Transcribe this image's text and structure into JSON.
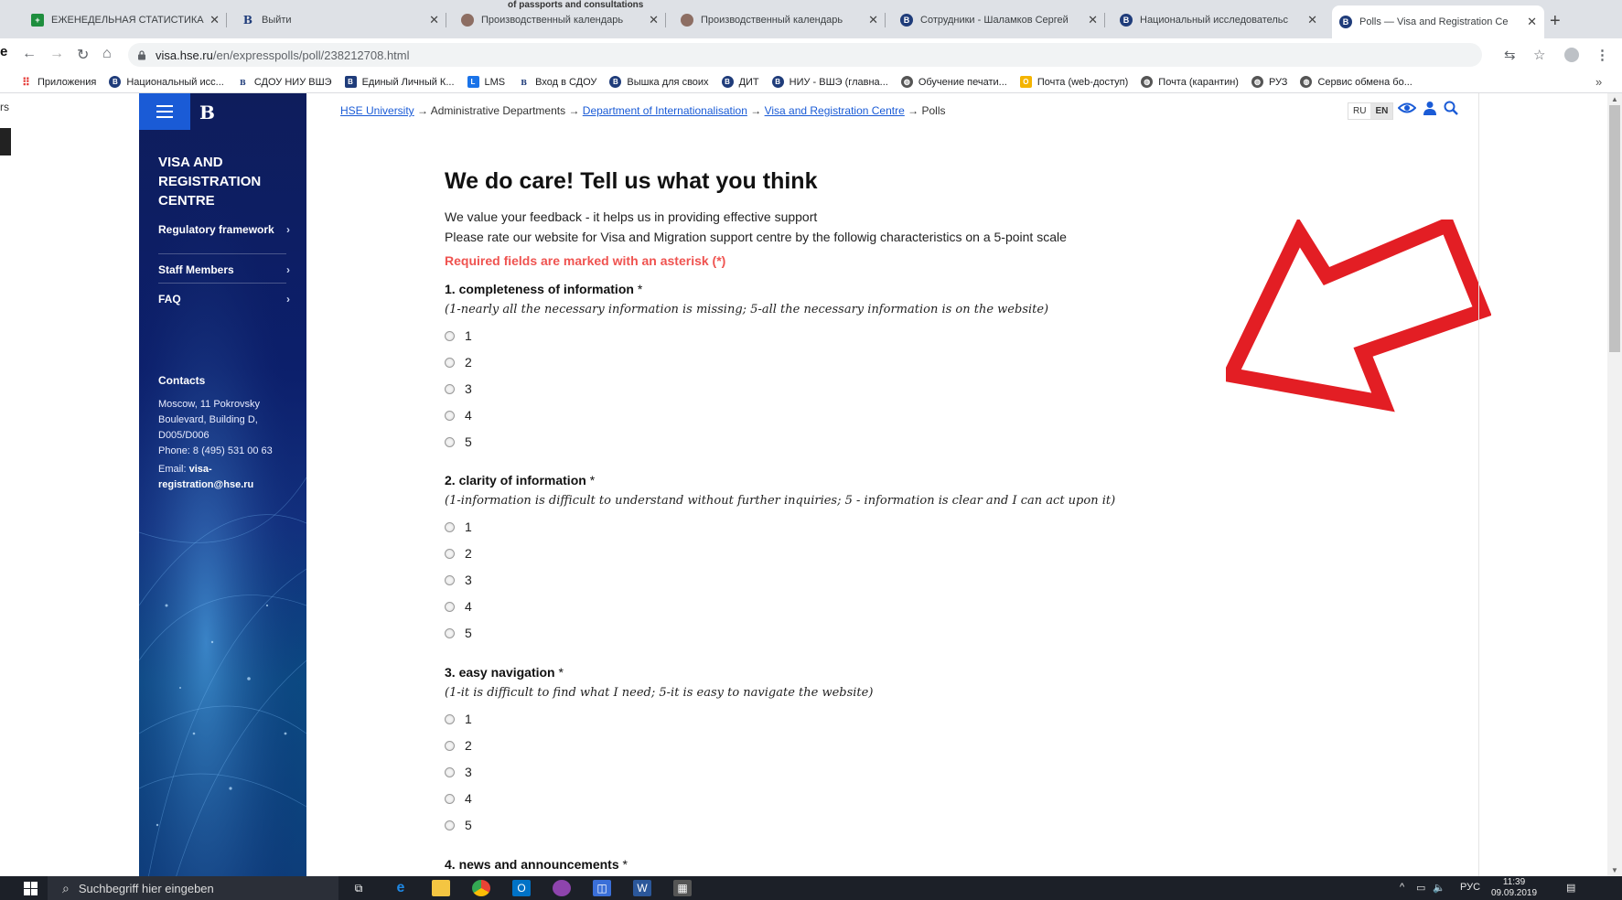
{
  "browser": {
    "ghost_text": "of passports and consultations",
    "tabs": [
      {
        "label": "ЕЖЕНЕДЕЛЬНАЯ СТАТИСТИКА",
        "icon": "sheets-icon"
      },
      {
        "label": "Выйти",
        "icon": "hse-logo-icon"
      },
      {
        "label": "Производственный календарь",
        "icon": "calendar-icon"
      },
      {
        "label": "Производственный календарь",
        "icon": "calendar-icon"
      },
      {
        "label": "Сотрудники - Шаламков Сергей",
        "icon": "hse-icon"
      },
      {
        "label": "Национальный исследовательс",
        "icon": "hse-icon"
      },
      {
        "label": "Polls — Visa and Registration Ce",
        "icon": "hse-icon",
        "active": true
      }
    ],
    "new_tab": "+",
    "url_host": "visa.hse.ru",
    "url_path": "/en/expresspolls/poll/238212708.html",
    "bookmarks": [
      "Приложения",
      "Национальный исс...",
      "СДОУ НИУ ВШЭ",
      "Единый Личный К...",
      "LMS",
      "Вход в СДОУ",
      "Вышка для своих",
      "ДИТ",
      "НИУ - ВШЭ (главна...",
      "Обучение печати...",
      "Почта (web-доступ)",
      "Почта (карантин)",
      "РУЗ",
      "Сервис обмена бо..."
    ],
    "bookmarks_more": "»"
  },
  "gutter": {
    "text": "rs"
  },
  "sidebar": {
    "logo": "B",
    "title": "VISA AND REGISTRATION CENTRE",
    "items": [
      {
        "label": "Regulatory framework"
      },
      {
        "label": "Staff Members"
      },
      {
        "label": "FAQ"
      }
    ],
    "contacts_heading": "Contacts",
    "address": "Moscow, 11 Pokrovsky Boulevard, Building D, D005/D006",
    "phone": "Phone: 8 (495) 531 00 63",
    "email_label": "Email:",
    "email": "visa-registration@hse.ru"
  },
  "breadcrumb": {
    "items": [
      "HSE University",
      "Administrative Departments",
      "Department of Internationalisation",
      "Visa and Registration Centre",
      "Polls"
    ],
    "separator": "→"
  },
  "lang": {
    "ru": "RU",
    "en": "EN"
  },
  "page": {
    "title": "We do care! Tell us what you think",
    "intro_1": "We value your feedback - it helps us in providing effective support",
    "intro_2": "Please rate our website for Visa and Migration support centre by the followig characteristics on a 5-point scale",
    "required_note": "Required fields are marked with an asterisk (*)",
    "questions": [
      {
        "title": "1. completeness of information",
        "asterisk": "*",
        "hint": "(1-nearly all the necessary information is missing; 5-all the necessary information is on the website)",
        "options": [
          "1",
          "2",
          "3",
          "4",
          "5"
        ]
      },
      {
        "title": "2. clarity of information",
        "asterisk": "*",
        "hint": "(1-information is difficult to understand without further inquiries; 5 - information is clear and I can act upon it)",
        "options": [
          "1",
          "2",
          "3",
          "4",
          "5"
        ]
      },
      {
        "title": "3. easy navigation",
        "asterisk": "*",
        "hint": "(1-it is difficult to find what I need; 5-it is easy to navigate the website)",
        "options": [
          "1",
          "2",
          "3",
          "4",
          "5"
        ]
      },
      {
        "title": "4. news and announcements",
        "asterisk": "*"
      }
    ]
  },
  "annotation": {
    "arrow_color": "#e31e24"
  },
  "taskbar": {
    "search_placeholder": "Suchbegriff hier eingeben",
    "tray_lang": "РУС",
    "time": "11:39",
    "date": "09.09.2019"
  },
  "colors": {
    "sidebar_accent": "#1a5bd6",
    "link": "#1a5bd6",
    "required": "#ef5350"
  }
}
